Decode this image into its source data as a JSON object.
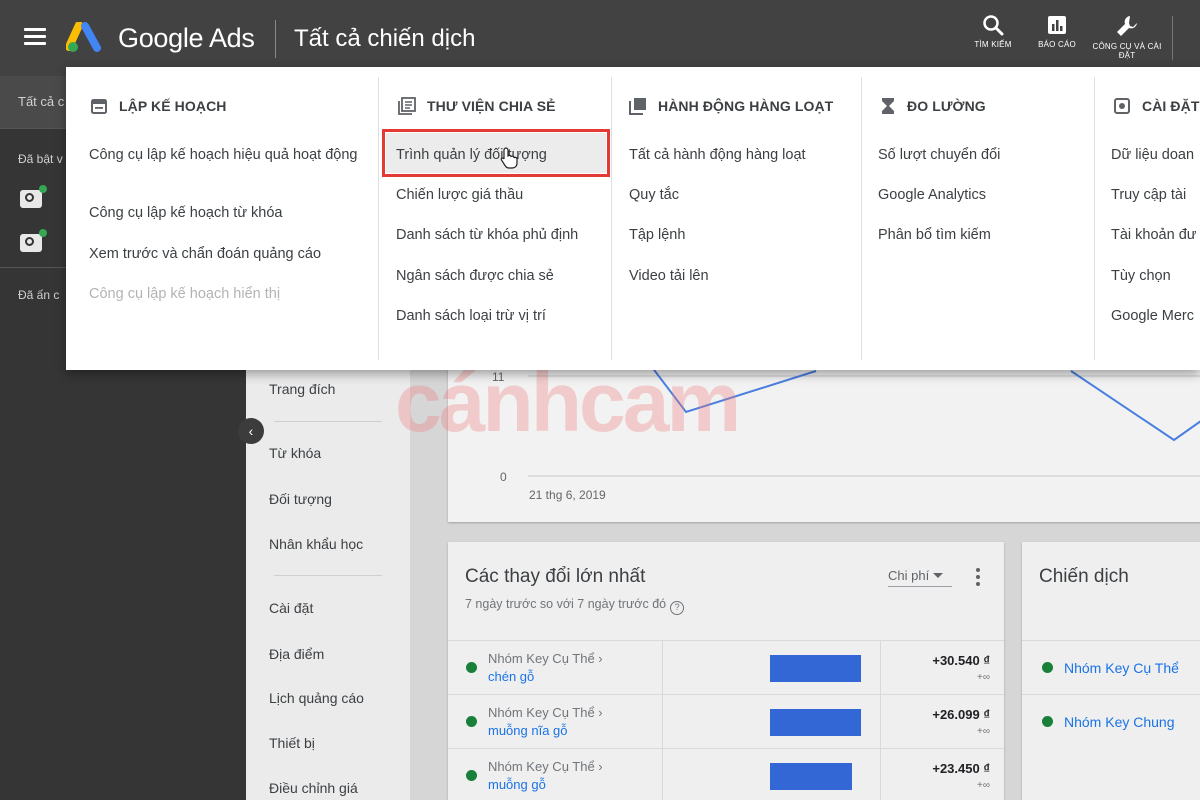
{
  "header": {
    "product_name": "Google Ads",
    "page_title": "Tất cả chiến dịch",
    "actions": [
      {
        "icon": "search-icon",
        "label": "TÌM KIẾM"
      },
      {
        "icon": "bar-chart-icon",
        "label": "BÁO CÁO"
      },
      {
        "icon": "wrench-icon",
        "label": "CÔNG CỤ VÀ CÀI ĐẶT"
      }
    ]
  },
  "left_nav": {
    "all_label": "Tất cả c",
    "enabled_label": "Đã bật v",
    "hidden_label": "Đã ấn c"
  },
  "page_nav": {
    "items": [
      "Trang đích",
      "Từ khóa",
      "Đối tượng",
      "Nhân khẩu học",
      "Cài đặt",
      "Địa điểm",
      "Lịch quảng cáo",
      "Thiết bị",
      "Điều chỉnh giá"
    ]
  },
  "chart": {
    "y_tick_top": "11",
    "y_tick_bottom": "0",
    "x_label": "21 thg 6, 2019"
  },
  "changes_card": {
    "title": "Các thay đổi lớn nhất",
    "subtitle": "7 ngày trước so với 7 ngày trước đó",
    "sort_label": "Chi phí",
    "rows": [
      {
        "path": "Nhóm Key Cụ Thể ›",
        "name": "chén gỗ",
        "value": "+30.540 ₫",
        "pct": "+∞",
        "bar_fraction": 1.0
      },
      {
        "path": "Nhóm Key Cụ Thể ›",
        "name": "muỗng nĩa gỗ",
        "value": "+26.099 ₫",
        "pct": "+∞",
        "bar_fraction": 1.0
      },
      {
        "path": "Nhóm Key Cụ Thể ›",
        "name": "muỗng gỗ",
        "value": "+23.450 ₫",
        "pct": "+∞",
        "bar_fraction": 0.9
      }
    ]
  },
  "campaign_card": {
    "title": "Chiến dịch",
    "rows": [
      "Nhóm Key Cụ Thể",
      "Nhóm Key Chung"
    ]
  },
  "watermark": "cánhcam",
  "mega_menu": {
    "columns": [
      {
        "icon": "calendar-icon",
        "heading": "LẬP KẾ HOẠCH",
        "items": [
          "Công cụ lập kế hoạch hiệu quả hoạt động",
          "Công cụ lập kế hoạch từ khóa",
          "Xem trước và chẩn đoán quảng cáo",
          "Công cụ lập kế hoạch hiển thị"
        ]
      },
      {
        "icon": "library-icon",
        "heading": "THƯ VIỆN CHIA SẺ",
        "items": [
          "Trình quản lý đối tượng",
          "Chiến lược giá thầu",
          "Danh sách từ khóa phủ định",
          "Ngân sách được chia sẻ",
          "Danh sách loại trừ vị trí"
        ]
      },
      {
        "icon": "copy-icon",
        "heading": "HÀNH ĐỘNG HÀNG LOẠT",
        "items": [
          "Tất cả hành động hàng loạt",
          "Quy tắc",
          "Tập lệnh",
          "Video tải lên"
        ]
      },
      {
        "icon": "hourglass-icon",
        "heading": "ĐO LƯỜNG",
        "items": [
          "Số lượt chuyển đổi",
          "Google Analytics",
          "Phân bổ tìm kiếm"
        ]
      },
      {
        "icon": "settings-icon",
        "heading": "CÀI ĐẶT",
        "items": [
          "Dữ liệu doan",
          "Truy cập tài",
          "Tài khoản đư",
          "Tùy chọn",
          "Google Merc"
        ]
      }
    ]
  },
  "colors": {
    "accent_blue": "#1a73e8",
    "bar_blue": "#3367d6",
    "highlight_red": "#e53935",
    "status_green": "#188038"
  }
}
